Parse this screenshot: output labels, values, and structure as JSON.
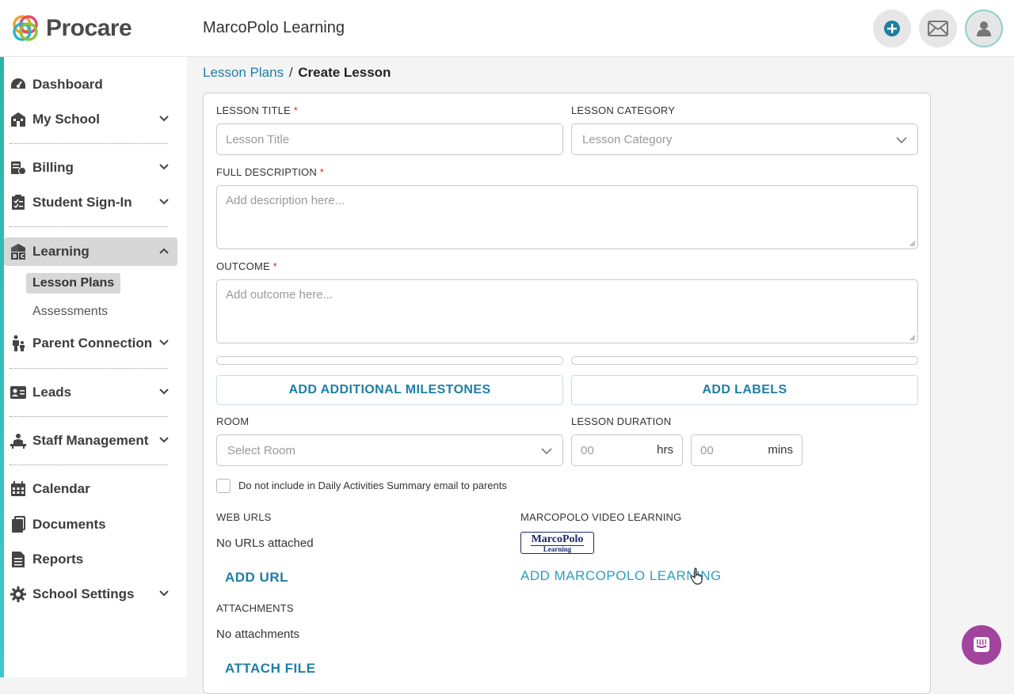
{
  "app": {
    "brand": "Procare",
    "school_name": "MarcoPolo Learning"
  },
  "header": {
    "add_icon": "plus-circle-icon",
    "mail_icon": "envelope-icon",
    "avatar_icon": "user-icon"
  },
  "sidebar": {
    "items": [
      {
        "label": "Dashboard",
        "icon": "dashboard-icon"
      },
      {
        "label": "My School",
        "icon": "school-icon"
      },
      {
        "label": "Billing",
        "icon": "billing-icon"
      },
      {
        "label": "Student Sign-In",
        "icon": "checklist-icon"
      },
      {
        "label": "Learning",
        "icon": "blocks-icon"
      },
      {
        "label": "Parent Connection",
        "icon": "family-icon"
      },
      {
        "label": "Leads",
        "icon": "id-card-icon"
      },
      {
        "label": "Staff Management",
        "icon": "staff-icon"
      },
      {
        "label": "Calendar",
        "icon": "calendar-icon"
      },
      {
        "label": "Documents",
        "icon": "documents-icon"
      },
      {
        "label": "Reports",
        "icon": "report-icon"
      },
      {
        "label": "School Settings",
        "icon": "gear-icon"
      }
    ],
    "learning_sub": [
      "Lesson Plans",
      "Assessments"
    ]
  },
  "breadcrumb": {
    "parent": "Lesson Plans",
    "separator": "/",
    "current": "Create Lesson"
  },
  "form": {
    "lesson_title_label": "LESSON TITLE",
    "lesson_title_placeholder": "Lesson Title",
    "lesson_category_label": "LESSON CATEGORY",
    "lesson_category_placeholder": "Lesson Category",
    "description_label": "FULL DESCRIPTION",
    "description_placeholder": "Add description here...",
    "outcome_label": "OUTCOME",
    "outcome_placeholder": "Add outcome here...",
    "required_mark": "*",
    "add_milestones": "ADD ADDITIONAL MILESTONES",
    "add_labels": "ADD LABELS",
    "room_label": "ROOM",
    "room_placeholder": "Select Room",
    "duration_label": "LESSON DURATION",
    "hours_placeholder": "00",
    "hours_unit": "hrs",
    "minutes_placeholder": "00",
    "minutes_unit": "mins",
    "exclude_email_label": "Do not include in Daily Activities Summary email to parents",
    "web_urls_label": "WEB URLS",
    "no_urls": "No URLs attached",
    "add_url": "ADD URL",
    "marcopolo_label": "MARCOPOLO VIDEO LEARNING",
    "marcopolo_logo_title": "MarcoPolo",
    "marcopolo_logo_sub": "Learning",
    "add_marcopolo": "ADD MARCOPOLO LEARNING",
    "attachments_label": "ATTACHMENTS",
    "no_attachments": "No attachments",
    "attach_file": "ATTACH FILE"
  },
  "colors": {
    "accent": "#1e7ea5",
    "active_nav": "#d7d7d7",
    "chat": "#a0449e",
    "required": "#dd2222"
  }
}
